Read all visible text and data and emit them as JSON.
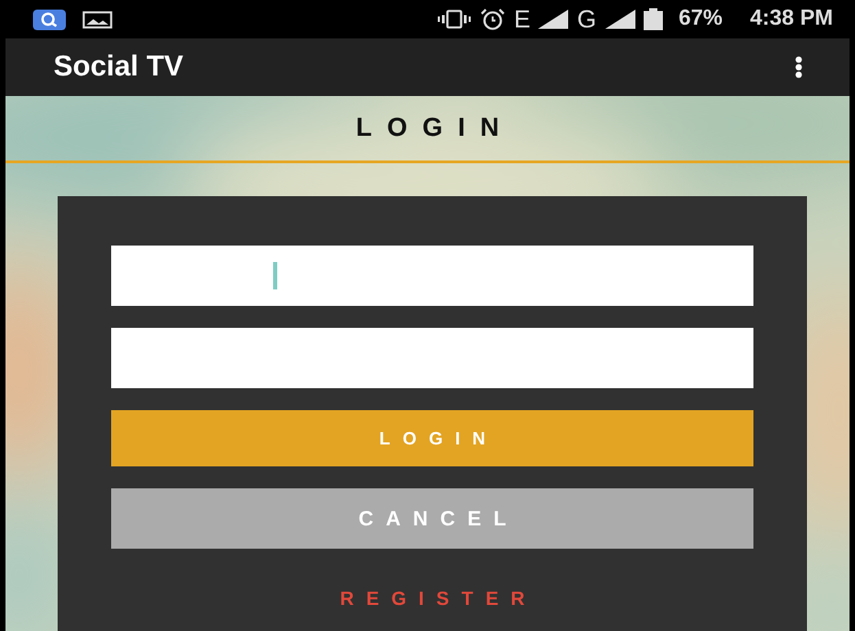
{
  "status_bar": {
    "network_letters": [
      "E",
      "G"
    ],
    "battery": "67%",
    "time": "4:38 PM"
  },
  "app_bar": {
    "title": "Social TV"
  },
  "page": {
    "title": "LOGIN"
  },
  "form": {
    "fields": [
      {
        "focused": true
      },
      {
        "focused": false
      }
    ],
    "buttons": [
      {
        "kind": "primary",
        "label": "LOGIN"
      },
      {
        "kind": "secondary",
        "label": "CANCEL"
      }
    ],
    "link": "REGISTER"
  }
}
